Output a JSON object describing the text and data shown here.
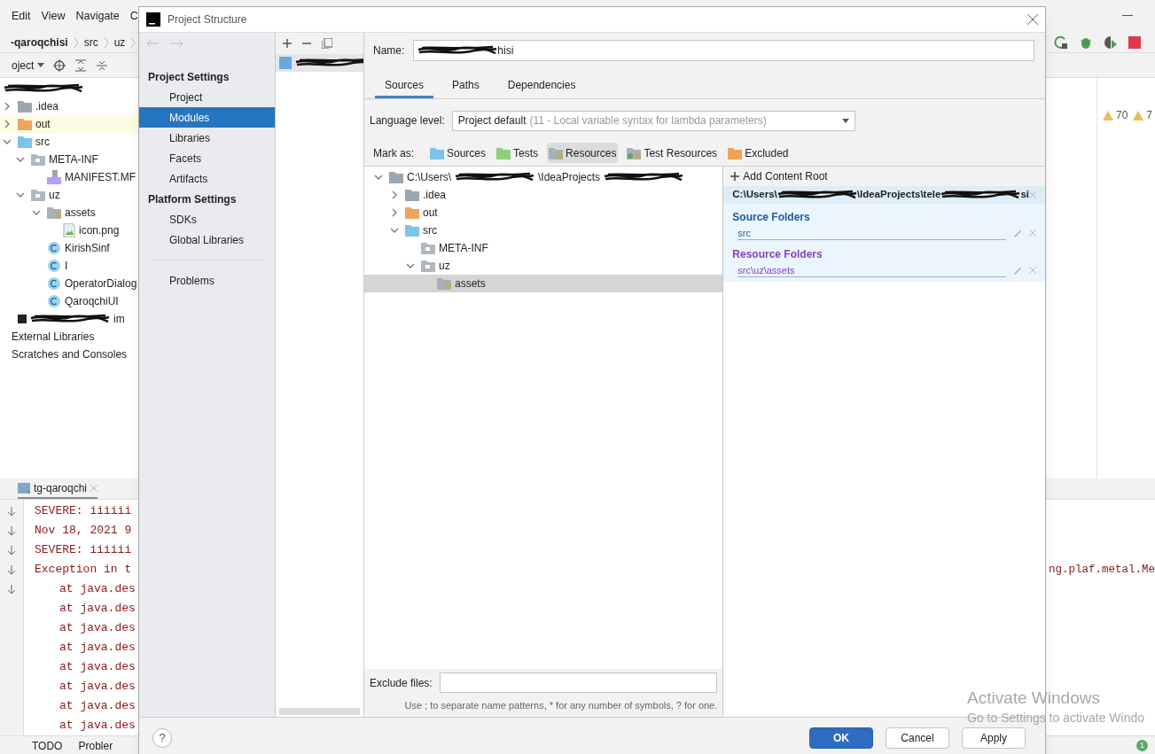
{
  "ide": {
    "menu": [
      "Edit",
      "View",
      "Navigate",
      "C"
    ],
    "breadcrumb": [
      "-qaroqchisi",
      "src",
      "uz"
    ],
    "project_view": "oject",
    "tree": [
      {
        "segments": [
          {
            "kind": "redacted"
          }
        ],
        "children": [
          {
            "label": ".idea",
            "kind": "folder-plain",
            "expanded": false
          },
          {
            "label": "out",
            "kind": "folder-excluded",
            "expanded": false,
            "selected": true
          },
          {
            "label": "src",
            "kind": "folder-source",
            "expanded": true,
            "children": [
              {
                "label": "META-INF",
                "kind": "folder-package",
                "expanded": true,
                "children": [
                  {
                    "label": "MANIFEST.MF",
                    "kind": "file-manifest"
                  }
                ]
              },
              {
                "label": "uz",
                "kind": "folder-package",
                "expanded": true,
                "children": [
                  {
                    "label": "assets",
                    "kind": "folder-resource",
                    "expanded": true,
                    "children": [
                      {
                        "label": "icon.png",
                        "kind": "file-image"
                      }
                    ]
                  },
                  {
                    "label": "KirishSinf",
                    "kind": "class"
                  },
                  {
                    "label": "I",
                    "kind": "class"
                  },
                  {
                    "label": "OperatorDialog",
                    "kind": "class"
                  },
                  {
                    "label": "QaroqchiUI",
                    "kind": "class"
                  }
                ]
              }
            ]
          },
          {
            "segments": [
              {
                "kind": "redacted"
              },
              {
                "kind": "text",
                "text": "im"
              }
            ],
            "kind": "file-module"
          }
        ]
      },
      {
        "label": "External Libraries"
      },
      {
        "label": "Scratches and Consoles"
      }
    ],
    "warnings": [
      "70",
      "7"
    ],
    "run_tab": "tg-qaroqchi",
    "console": [
      {
        "text": "SEVERE: iiiiii",
        "kind": "message"
      },
      {
        "text": "Nov 18, 2021 9",
        "kind": "message"
      },
      {
        "text": "SEVERE: iiiiii",
        "kind": "message"
      },
      {
        "text": "Exception in t",
        "kind": "message",
        "right": "ng.plaf.metal.Me"
      },
      {
        "text": "at java.des",
        "kind": "trace"
      },
      {
        "text": "at java.des",
        "kind": "trace"
      },
      {
        "text": "at java.des",
        "kind": "trace"
      },
      {
        "text": "at java.des",
        "kind": "trace"
      },
      {
        "text": "at java.des",
        "kind": "trace"
      },
      {
        "text": "at java.des",
        "kind": "trace"
      },
      {
        "text": "at java.des",
        "kind": "trace"
      },
      {
        "text": "at java.des",
        "kind": "trace"
      }
    ],
    "bottom_tabs": [
      "TODO",
      "Probler"
    ],
    "notification_count": "1"
  },
  "dialog": {
    "title": "Project Structure",
    "nav": [
      {
        "title": "Project Settings",
        "items": [
          {
            "label": "Project",
            "selected": false
          },
          {
            "label": "Modules",
            "selected": true
          },
          {
            "label": "Libraries",
            "selected": false
          },
          {
            "label": "Facets",
            "selected": false
          },
          {
            "label": "Artifacts",
            "selected": false
          }
        ]
      },
      {
        "title": "Platform Settings",
        "items": [
          {
            "label": "SDKs",
            "selected": false
          },
          {
            "label": "Global Libraries",
            "selected": false
          }
        ]
      }
    ],
    "problems": "Problems",
    "modules": [
      {
        "segments": [
          {
            "kind": "redacted"
          }
        ],
        "selected": true
      }
    ],
    "name_label": "Name:",
    "name_value": [
      {
        "kind": "redacted"
      },
      {
        "kind": "text",
        "text": "hisi"
      }
    ],
    "tabs": [
      {
        "label": "Sources",
        "selected": true
      },
      {
        "label": "Paths",
        "selected": false
      },
      {
        "label": "Dependencies",
        "selected": false
      }
    ],
    "language_label": "Language level:",
    "language_value": "Project default",
    "language_hint": "(11 - Local variable syntax for lambda parameters)",
    "mark_label": "Mark as:",
    "mark_buttons": [
      {
        "label": "Sources",
        "kind": "folder-source",
        "selected": false
      },
      {
        "label": "Tests",
        "kind": "folder-test",
        "selected": false
      },
      {
        "label": "Resources",
        "kind": "folder-resource",
        "selected": true
      },
      {
        "label": "Test Resources",
        "kind": "folder-test-resource",
        "selected": false
      },
      {
        "label": "Excluded",
        "kind": "folder-excluded",
        "selected": false
      }
    ],
    "tree": [
      {
        "segments": [
          {
            "kind": "text",
            "text": "C:\\Users\\"
          },
          {
            "kind": "redacted"
          },
          {
            "kind": "text",
            "text": "\\IdeaProjects"
          },
          {
            "kind": "redacted"
          }
        ],
        "kind": "folder-plain",
        "expanded": true,
        "children": [
          {
            "label": ".idea",
            "kind": "folder-plain",
            "expanded": false
          },
          {
            "label": "out",
            "kind": "folder-excluded",
            "expanded": false
          },
          {
            "label": "src",
            "kind": "folder-source",
            "expanded": true,
            "children": [
              {
                "label": "META-INF",
                "kind": "folder-package"
              },
              {
                "label": "uz",
                "kind": "folder-package",
                "expanded": true,
                "children": [
                  {
                    "label": "assets",
                    "kind": "folder-resource",
                    "selected": true
                  }
                ]
              }
            ]
          }
        ]
      }
    ],
    "add_root": "Add Content Root",
    "root_path": [
      {
        "kind": "text",
        "text": "C:\\Users\\"
      },
      {
        "kind": "redacted"
      },
      {
        "kind": "text",
        "text": "\\IdeaProjects\\tele"
      },
      {
        "kind": "redacted"
      },
      {
        "kind": "text",
        "text": "si"
      }
    ],
    "folder_groups": [
      {
        "title": "Source Folders",
        "kind": "source",
        "items": [
          "src"
        ]
      },
      {
        "title": "Resource Folders",
        "kind": "resource",
        "items": [
          "src\\uz\\assets"
        ]
      }
    ],
    "exclude_label": "Exclude files:",
    "exclude_hint": "Use ; to separate name patterns, * for any number of symbols, ? for one.",
    "help": "?",
    "buttons": [
      {
        "label": "OK",
        "kind": "primary"
      },
      {
        "label": "Cancel",
        "kind": "normal"
      },
      {
        "label": "Apply",
        "kind": "normal"
      }
    ]
  },
  "os_notice": {
    "title": "Activate Windows",
    "text": "Go to Settings to activate Windo"
  }
}
